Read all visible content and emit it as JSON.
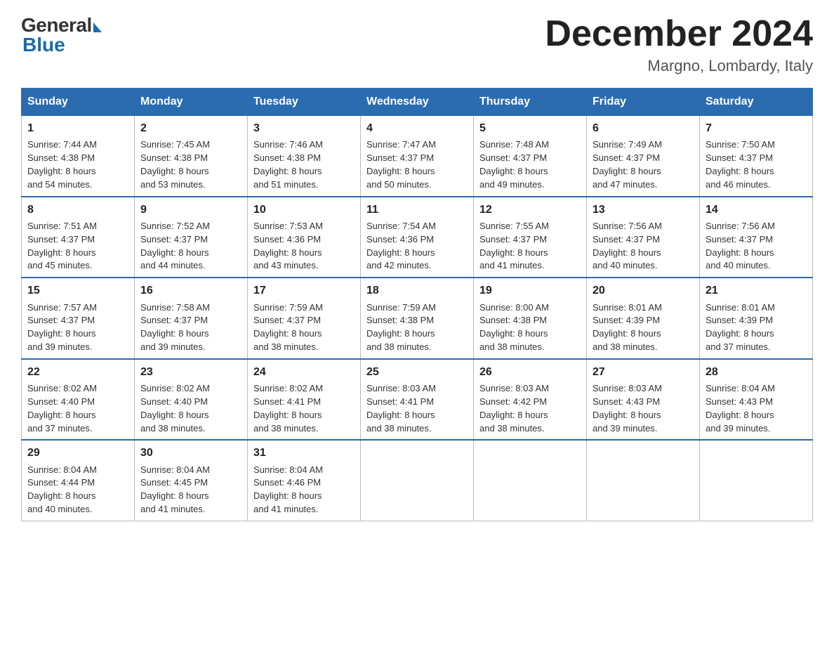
{
  "header": {
    "logo_general": "General",
    "logo_blue": "Blue",
    "month_title": "December 2024",
    "location": "Margno, Lombardy, Italy"
  },
  "days_of_week": [
    "Sunday",
    "Monday",
    "Tuesday",
    "Wednesday",
    "Thursday",
    "Friday",
    "Saturday"
  ],
  "weeks": [
    [
      {
        "day": "1",
        "sunrise": "7:44 AM",
        "sunset": "4:38 PM",
        "daylight": "8 hours and 54 minutes."
      },
      {
        "day": "2",
        "sunrise": "7:45 AM",
        "sunset": "4:38 PM",
        "daylight": "8 hours and 53 minutes."
      },
      {
        "day": "3",
        "sunrise": "7:46 AM",
        "sunset": "4:38 PM",
        "daylight": "8 hours and 51 minutes."
      },
      {
        "day": "4",
        "sunrise": "7:47 AM",
        "sunset": "4:37 PM",
        "daylight": "8 hours and 50 minutes."
      },
      {
        "day": "5",
        "sunrise": "7:48 AM",
        "sunset": "4:37 PM",
        "daylight": "8 hours and 49 minutes."
      },
      {
        "day": "6",
        "sunrise": "7:49 AM",
        "sunset": "4:37 PM",
        "daylight": "8 hours and 47 minutes."
      },
      {
        "day": "7",
        "sunrise": "7:50 AM",
        "sunset": "4:37 PM",
        "daylight": "8 hours and 46 minutes."
      }
    ],
    [
      {
        "day": "8",
        "sunrise": "7:51 AM",
        "sunset": "4:37 PM",
        "daylight": "8 hours and 45 minutes."
      },
      {
        "day": "9",
        "sunrise": "7:52 AM",
        "sunset": "4:37 PM",
        "daylight": "8 hours and 44 minutes."
      },
      {
        "day": "10",
        "sunrise": "7:53 AM",
        "sunset": "4:36 PM",
        "daylight": "8 hours and 43 minutes."
      },
      {
        "day": "11",
        "sunrise": "7:54 AM",
        "sunset": "4:36 PM",
        "daylight": "8 hours and 42 minutes."
      },
      {
        "day": "12",
        "sunrise": "7:55 AM",
        "sunset": "4:37 PM",
        "daylight": "8 hours and 41 minutes."
      },
      {
        "day": "13",
        "sunrise": "7:56 AM",
        "sunset": "4:37 PM",
        "daylight": "8 hours and 40 minutes."
      },
      {
        "day": "14",
        "sunrise": "7:56 AM",
        "sunset": "4:37 PM",
        "daylight": "8 hours and 40 minutes."
      }
    ],
    [
      {
        "day": "15",
        "sunrise": "7:57 AM",
        "sunset": "4:37 PM",
        "daylight": "8 hours and 39 minutes."
      },
      {
        "day": "16",
        "sunrise": "7:58 AM",
        "sunset": "4:37 PM",
        "daylight": "8 hours and 39 minutes."
      },
      {
        "day": "17",
        "sunrise": "7:59 AM",
        "sunset": "4:37 PM",
        "daylight": "8 hours and 38 minutes."
      },
      {
        "day": "18",
        "sunrise": "7:59 AM",
        "sunset": "4:38 PM",
        "daylight": "8 hours and 38 minutes."
      },
      {
        "day": "19",
        "sunrise": "8:00 AM",
        "sunset": "4:38 PM",
        "daylight": "8 hours and 38 minutes."
      },
      {
        "day": "20",
        "sunrise": "8:01 AM",
        "sunset": "4:39 PM",
        "daylight": "8 hours and 38 minutes."
      },
      {
        "day": "21",
        "sunrise": "8:01 AM",
        "sunset": "4:39 PM",
        "daylight": "8 hours and 37 minutes."
      }
    ],
    [
      {
        "day": "22",
        "sunrise": "8:02 AM",
        "sunset": "4:40 PM",
        "daylight": "8 hours and 37 minutes."
      },
      {
        "day": "23",
        "sunrise": "8:02 AM",
        "sunset": "4:40 PM",
        "daylight": "8 hours and 38 minutes."
      },
      {
        "day": "24",
        "sunrise": "8:02 AM",
        "sunset": "4:41 PM",
        "daylight": "8 hours and 38 minutes."
      },
      {
        "day": "25",
        "sunrise": "8:03 AM",
        "sunset": "4:41 PM",
        "daylight": "8 hours and 38 minutes."
      },
      {
        "day": "26",
        "sunrise": "8:03 AM",
        "sunset": "4:42 PM",
        "daylight": "8 hours and 38 minutes."
      },
      {
        "day": "27",
        "sunrise": "8:03 AM",
        "sunset": "4:43 PM",
        "daylight": "8 hours and 39 minutes."
      },
      {
        "day": "28",
        "sunrise": "8:04 AM",
        "sunset": "4:43 PM",
        "daylight": "8 hours and 39 minutes."
      }
    ],
    [
      {
        "day": "29",
        "sunrise": "8:04 AM",
        "sunset": "4:44 PM",
        "daylight": "8 hours and 40 minutes."
      },
      {
        "day": "30",
        "sunrise": "8:04 AM",
        "sunset": "4:45 PM",
        "daylight": "8 hours and 41 minutes."
      },
      {
        "day": "31",
        "sunrise": "8:04 AM",
        "sunset": "4:46 PM",
        "daylight": "8 hours and 41 minutes."
      },
      null,
      null,
      null,
      null
    ]
  ],
  "labels": {
    "sunrise": "Sunrise:",
    "sunset": "Sunset:",
    "daylight": "Daylight:"
  }
}
